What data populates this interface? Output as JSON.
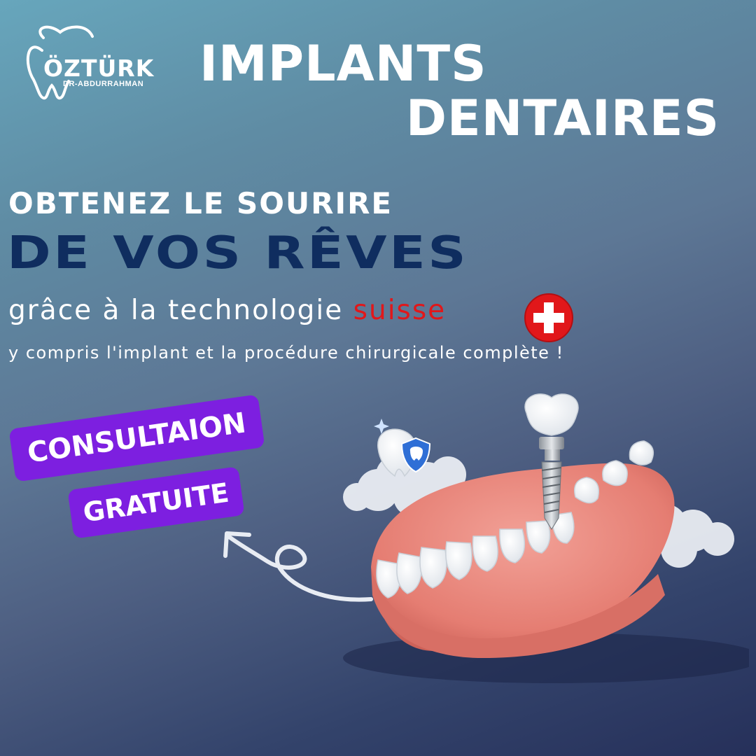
{
  "brand": {
    "name": "ÖZTÜRK",
    "subtitle": "DR-ABDURRAHMAN",
    "icon": "tooth-outline-icon"
  },
  "headline": {
    "line1": "IMPLANTS",
    "line2": "DENTAIRES"
  },
  "tagline": {
    "line1": "OBTENEZ LE SOURIRE",
    "line2": "DE VOS RÊVES",
    "line2_color": "#0f2d5f"
  },
  "technology": {
    "prefix": "grâce à la technologie ",
    "highlight": "suisse",
    "highlight_color": "#e1171a",
    "flag_icon": "swiss-flag-icon"
  },
  "description": "y compris l'implant et la procédure chirurgicale complète !",
  "offer": {
    "line1": "CONSULTAION",
    "line2": "GRATUITE",
    "color": "#7d1fe0"
  },
  "illustration": {
    "subject": "dental-implant-denture-illustration",
    "shield_icon": "tooth-shield-icon",
    "arrow_icon": "curly-arrow-icon"
  },
  "colors": {
    "background_top": "#67a6bc",
    "background_bottom": "#26305a",
    "gum": "#e9857c",
    "tooth": "#ffffff"
  }
}
